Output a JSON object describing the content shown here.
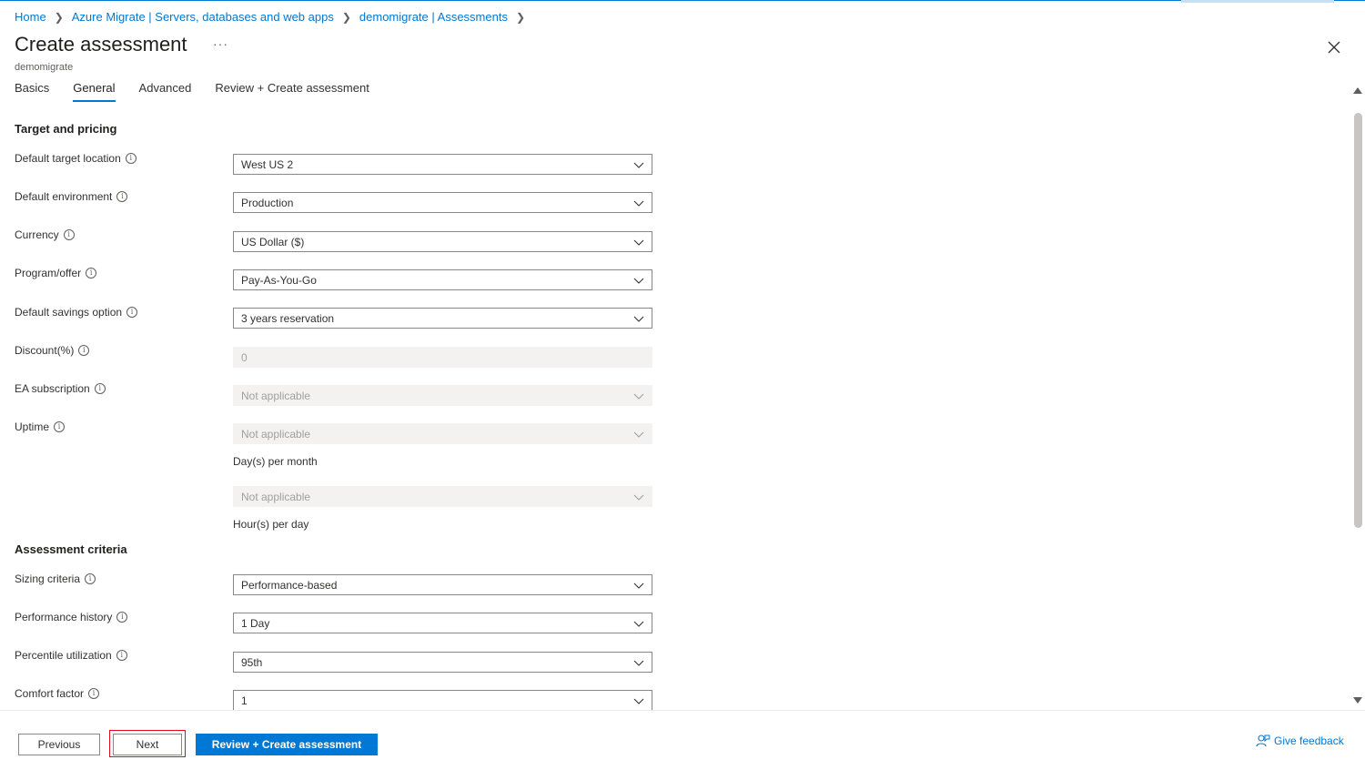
{
  "breadcrumb": [
    "Home",
    "Azure Migrate | Servers, databases and web apps",
    "demomigrate | Assessments"
  ],
  "header": {
    "title": "Create assessment",
    "more": "···",
    "subtitle": "demomigrate"
  },
  "tabs": [
    "Basics",
    "General",
    "Advanced",
    "Review + Create assessment"
  ],
  "active_tab": "General",
  "sections": {
    "target": "Target and pricing",
    "criteria": "Assessment criteria"
  },
  "fields": {
    "target_location": {
      "label": "Default target location",
      "value": "West US 2"
    },
    "environment": {
      "label": "Default environment",
      "value": "Production"
    },
    "currency": {
      "label": "Currency",
      "value": "US Dollar ($)"
    },
    "program": {
      "label": "Program/offer",
      "value": "Pay-As-You-Go"
    },
    "savings": {
      "label": "Default savings option",
      "value": "3 years reservation"
    },
    "discount": {
      "label": "Discount(%)",
      "value": "0"
    },
    "ea_subscription": {
      "label": "EA subscription",
      "value": "Not applicable"
    },
    "uptime": {
      "label": "Uptime",
      "value": "Not applicable",
      "helper": "Day(s) per month"
    },
    "uptime_hours": {
      "value": "Not applicable",
      "helper": "Hour(s) per day"
    },
    "sizing": {
      "label": "Sizing criteria",
      "value": "Performance-based"
    },
    "perf_history": {
      "label": "Performance history",
      "value": "1 Day"
    },
    "percentile": {
      "label": "Percentile utilization",
      "value": "95th"
    },
    "comfort": {
      "label": "Comfort factor",
      "value": "1"
    }
  },
  "footer": {
    "previous": "Previous",
    "next": "Next",
    "review": "Review + Create assessment",
    "feedback": "Give feedback"
  },
  "colors": {
    "accent": "#0078d4",
    "highlight_border": "#e00b1c"
  }
}
